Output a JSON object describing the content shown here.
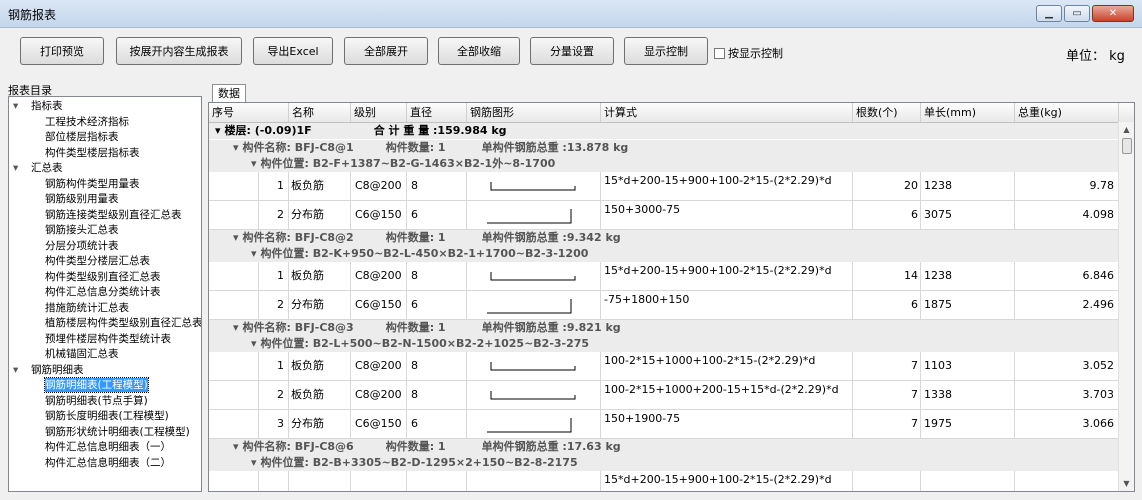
{
  "window": {
    "title": "钢筋报表"
  },
  "toolbar": {
    "buttons": [
      "打印预览",
      "按展开内容生成报表",
      "导出Excel",
      "全部展开",
      "全部收缩",
      "分量设置",
      "显示控制"
    ],
    "checkbox_label": "按显示控制",
    "unit_label": "单位： kg"
  },
  "tree": {
    "title": "报表目录",
    "nodes": [
      {
        "label": "指标表",
        "level": 0
      },
      {
        "label": "工程技术经济指标",
        "level": 1
      },
      {
        "label": "部位楼层指标表",
        "level": 1
      },
      {
        "label": "构件类型楼层指标表",
        "level": 1
      },
      {
        "label": "汇总表",
        "level": 0
      },
      {
        "label": "钢筋构件类型用量表",
        "level": 1
      },
      {
        "label": "钢筋级别用量表",
        "level": 1
      },
      {
        "label": "钢筋连接类型级别直径汇总表",
        "level": 1
      },
      {
        "label": "钢筋接头汇总表",
        "level": 1
      },
      {
        "label": "分层分项统计表",
        "level": 1
      },
      {
        "label": "构件类型分楼层汇总表",
        "level": 1
      },
      {
        "label": "构件类型级别直径汇总表",
        "level": 1
      },
      {
        "label": "构件汇总信息分类统计表",
        "level": 1
      },
      {
        "label": "措施筋统计汇总表",
        "level": 1
      },
      {
        "label": "植筋楼层构件类型级别直径汇总表",
        "level": 1
      },
      {
        "label": "预埋件楼层构件类型统计表",
        "level": 1
      },
      {
        "label": "机械锚固汇总表",
        "level": 1
      },
      {
        "label": "钢筋明细表",
        "level": 0
      },
      {
        "label": "钢筋明细表(工程模型)",
        "level": 1,
        "selected": true
      },
      {
        "label": "钢筋明细表(节点手算)",
        "level": 1
      },
      {
        "label": "钢筋长度明细表(工程模型)",
        "level": 1
      },
      {
        "label": "钢筋形状统计明细表(工程模型)",
        "level": 1
      },
      {
        "label": "构件汇总信息明细表（一）",
        "level": 1
      },
      {
        "label": "构件汇总信息明细表（二）",
        "level": 1
      }
    ]
  },
  "tabs": [
    {
      "label": "数据"
    }
  ],
  "grid": {
    "columns": [
      "序号",
      "名称",
      "级别",
      "直径",
      "钢筋图形",
      "计算式",
      "根数(个)",
      "单长(mm)",
      "总重(kg)"
    ],
    "rows": [
      {
        "type": "floor",
        "text": "楼层: (-0.09)1F",
        "extra": "合 计 重 量 :159.984 kg"
      },
      {
        "type": "member",
        "name": "构件名称: BFJ-C8@1",
        "count": "构件数量: 1",
        "weight": "单构件钢筋总重 :13.878 kg"
      },
      {
        "type": "pos",
        "text": "构件位置: B2-F+1387~B2-G-1463×B2-1外~8-1700"
      },
      {
        "type": "data",
        "no": "1",
        "name": "板负筋",
        "grade": "C8@200",
        "dia": "8",
        "shape": "u",
        "formula": "15*d+200-15+900+100-2*15-(2*2.29)*d",
        "qty": "20",
        "len": "1238",
        "wt": "9.78"
      },
      {
        "type": "data",
        "no": "2",
        "name": "分布筋",
        "grade": "C6@150",
        "dia": "6",
        "shape": "l",
        "formula": "150+3000-75",
        "qty": "6",
        "len": "3075",
        "wt": "4.098"
      },
      {
        "type": "member",
        "name": "构件名称: BFJ-C8@2",
        "count": "构件数量: 1",
        "weight": "单构件钢筋总重 :9.342 kg"
      },
      {
        "type": "pos",
        "text": "构件位置: B2-K+950~B2-L-450×B2-1+1700~B2-3-1200"
      },
      {
        "type": "data",
        "no": "1",
        "name": "板负筋",
        "grade": "C8@200",
        "dia": "8",
        "shape": "u",
        "formula": "15*d+200-15+900+100-2*15-(2*2.29)*d",
        "qty": "14",
        "len": "1238",
        "wt": "6.846"
      },
      {
        "type": "data",
        "no": "2",
        "name": "分布筋",
        "grade": "C6@150",
        "dia": "6",
        "shape": "l",
        "formula": "-75+1800+150",
        "qty": "6",
        "len": "1875",
        "wt": "2.496"
      },
      {
        "type": "member",
        "name": "构件名称: BFJ-C8@3",
        "count": "构件数量: 1",
        "weight": "单构件钢筋总重 :9.821 kg"
      },
      {
        "type": "pos",
        "text": "构件位置: B2-L+500~B2-N-1500×B2-2+1025~B2-3-275"
      },
      {
        "type": "data",
        "no": "1",
        "name": "板负筋",
        "grade": "C8@200",
        "dia": "8",
        "shape": "u",
        "formula": "100-2*15+1000+100-2*15-(2*2.29)*d",
        "qty": "7",
        "len": "1103",
        "wt": "3.052"
      },
      {
        "type": "data",
        "no": "2",
        "name": "板负筋",
        "grade": "C8@200",
        "dia": "8",
        "shape": "u",
        "formula": "100-2*15+1000+200-15+15*d-(2*2.29)*d",
        "qty": "7",
        "len": "1338",
        "wt": "3.703"
      },
      {
        "type": "data",
        "no": "3",
        "name": "分布筋",
        "grade": "C6@150",
        "dia": "6",
        "shape": "l",
        "formula": "150+1900-75",
        "qty": "7",
        "len": "1975",
        "wt": "3.066"
      },
      {
        "type": "member",
        "name": "构件名称: BFJ-C8@6",
        "count": "构件数量: 1",
        "weight": "单构件钢筋总重 :17.63 kg"
      },
      {
        "type": "pos",
        "text": "构件位置: B2-B+3305~B2-D-1295×2+150~B2-8-2175"
      },
      {
        "type": "data",
        "no": "",
        "name": "",
        "grade": "",
        "dia": "",
        "shape": "",
        "formula": "15*d+200-15+900+100-2*15-(2*2.29)*d",
        "qty": "",
        "len": "",
        "wt": ""
      }
    ]
  }
}
